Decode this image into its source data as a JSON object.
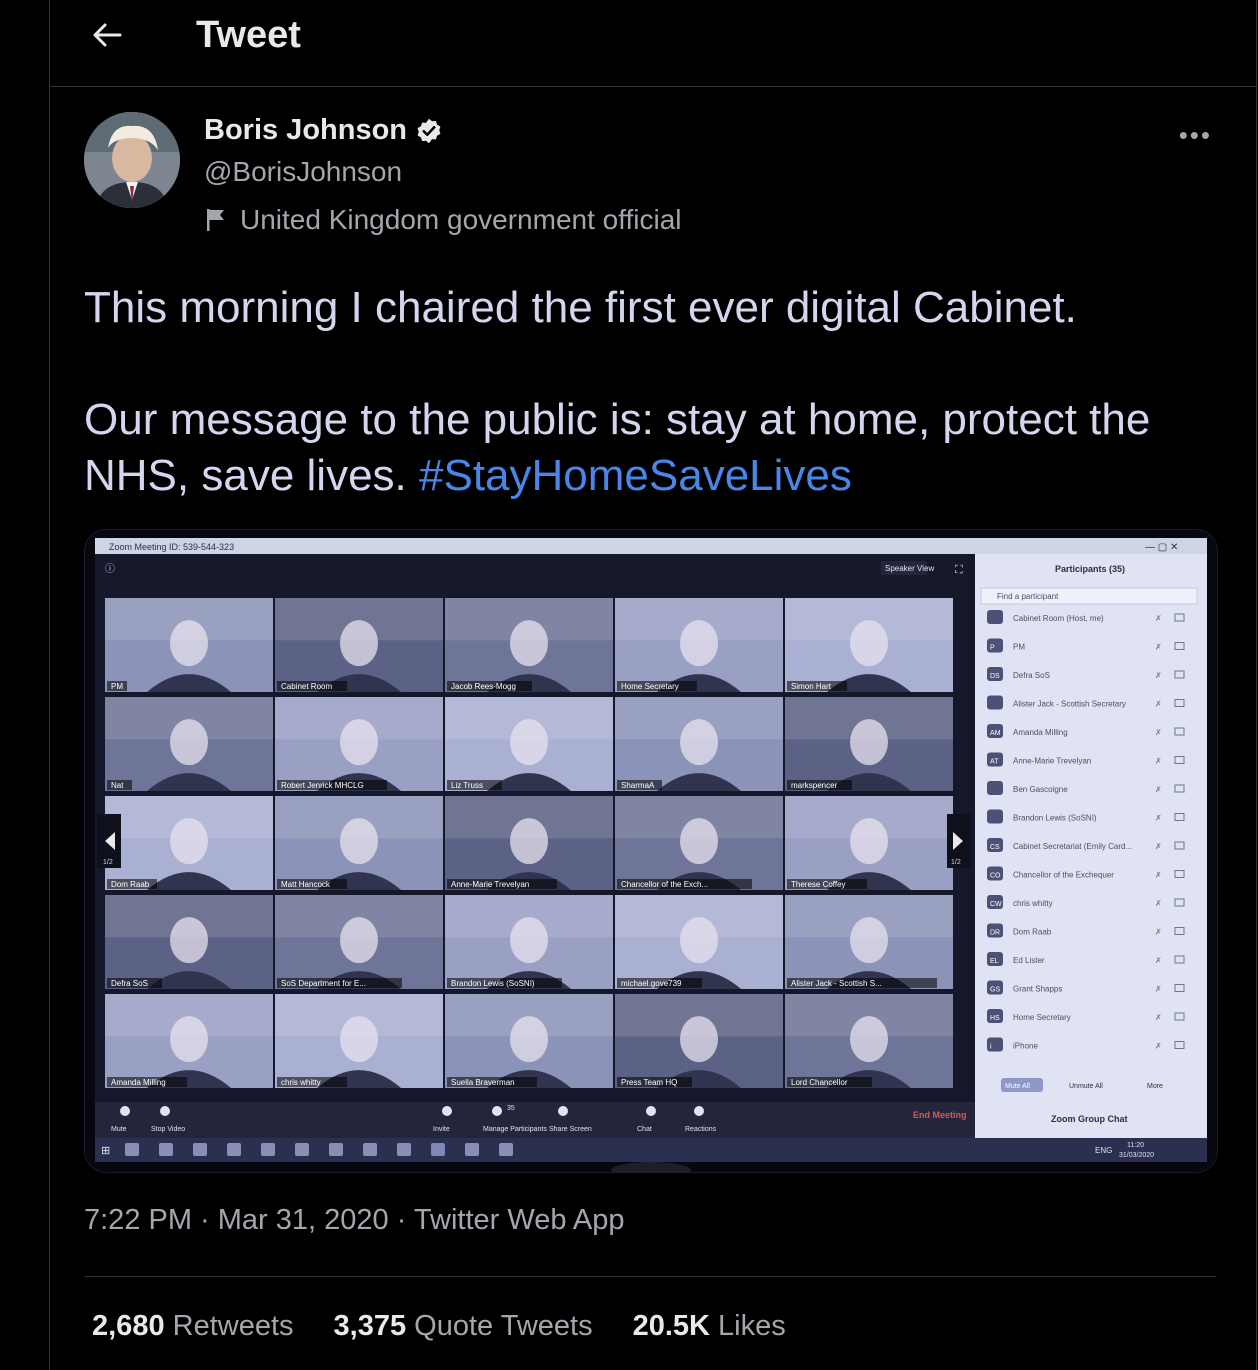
{
  "header": {
    "title": "Tweet"
  },
  "author": {
    "name": "Boris Johnson",
    "handle": "@BorisJohnson",
    "label": "United Kingdom government official"
  },
  "tweet": {
    "line1": "This morning I chaired the first ever digital Cabinet.",
    "line2": "Our message to the public is: stay at home, protect the NHS, save lives.",
    "hashtag": "#StayHomeSaveLives",
    "timestamp": "7:22 PM · Mar 31, 2020 · Twitter Web App"
  },
  "stats": [
    {
      "count": "2,680",
      "label": "Retweets"
    },
    {
      "count": "3,375",
      "label": "Quote Tweets"
    },
    {
      "count": "20.5K",
      "label": "Likes"
    }
  ],
  "zoom": {
    "window_title": "Zoom Meeting ID: 539-544-323",
    "speaker_view": "Speaker View",
    "page_indicator": "1/2",
    "tiles": [
      "PM",
      "Cabinet Room",
      "Jacob Rees-Mogg",
      "Home Secretary",
      "Simon Hart",
      "Nat",
      "Robert Jenrick MHCLG",
      "Liz Truss",
      "SharmaA",
      "markspencer",
      "Dom Raab",
      "Matt Hancock",
      "Anne-Marie Trevelyan",
      "Chancellor of the Exch...",
      "Therese Coffey",
      "Defra SoS",
      "SoS Department for E...",
      "Brandon Lewis (SoSNI)",
      "michael.gove739",
      "Alister Jack - Scottish S...",
      "Amanda Milling",
      "chris whitty",
      "Suella Braverman",
      "Press Team HQ",
      "Lord Chancellor"
    ],
    "participants_title": "Participants (35)",
    "find_placeholder": "Find a participant",
    "participants": [
      {
        "initials": "",
        "name": "Cabinet Room (Host, me)"
      },
      {
        "initials": "P",
        "name": "PM"
      },
      {
        "initials": "DS",
        "name": "Defra SoS"
      },
      {
        "initials": "",
        "name": "Alister Jack - Scottish Secretary"
      },
      {
        "initials": "AM",
        "name": "Amanda Milling"
      },
      {
        "initials": "AT",
        "name": "Anne-Marie Trevelyan"
      },
      {
        "initials": "",
        "name": "Ben Gascoigne"
      },
      {
        "initials": "",
        "name": "Brandon Lewis (SoSNI)"
      },
      {
        "initials": "CS",
        "name": "Cabinet Secretariat (Emily Card..."
      },
      {
        "initials": "CO",
        "name": "Chancellor of the Exchequer"
      },
      {
        "initials": "CW",
        "name": "chris whitty"
      },
      {
        "initials": "DR",
        "name": "Dom Raab"
      },
      {
        "initials": "EL",
        "name": "Ed Lister"
      },
      {
        "initials": "GS",
        "name": "Grant Shapps"
      },
      {
        "initials": "HS",
        "name": "Home Secretary"
      },
      {
        "initials": "i",
        "name": "iPhone"
      }
    ],
    "panel_buttons": [
      "Mute All",
      "Unmute All",
      "More"
    ],
    "group_chat": "Zoom Group Chat",
    "toolbar": [
      {
        "label": "Mute",
        "icon": "mic-icon"
      },
      {
        "label": "Stop Video",
        "icon": "video-icon"
      },
      {
        "label": "Invite",
        "icon": "invite-icon"
      },
      {
        "label": "Manage Participants",
        "icon": "participants-icon",
        "badge": "35"
      },
      {
        "label": "Share Screen",
        "icon": "share-icon"
      },
      {
        "label": "Chat",
        "icon": "chat-icon"
      },
      {
        "label": "Reactions",
        "icon": "reactions-icon"
      }
    ],
    "end_meeting": "End Meeting",
    "taskbar": {
      "lang": "ENG",
      "time": "11:20",
      "date": "31/03/2020"
    }
  }
}
